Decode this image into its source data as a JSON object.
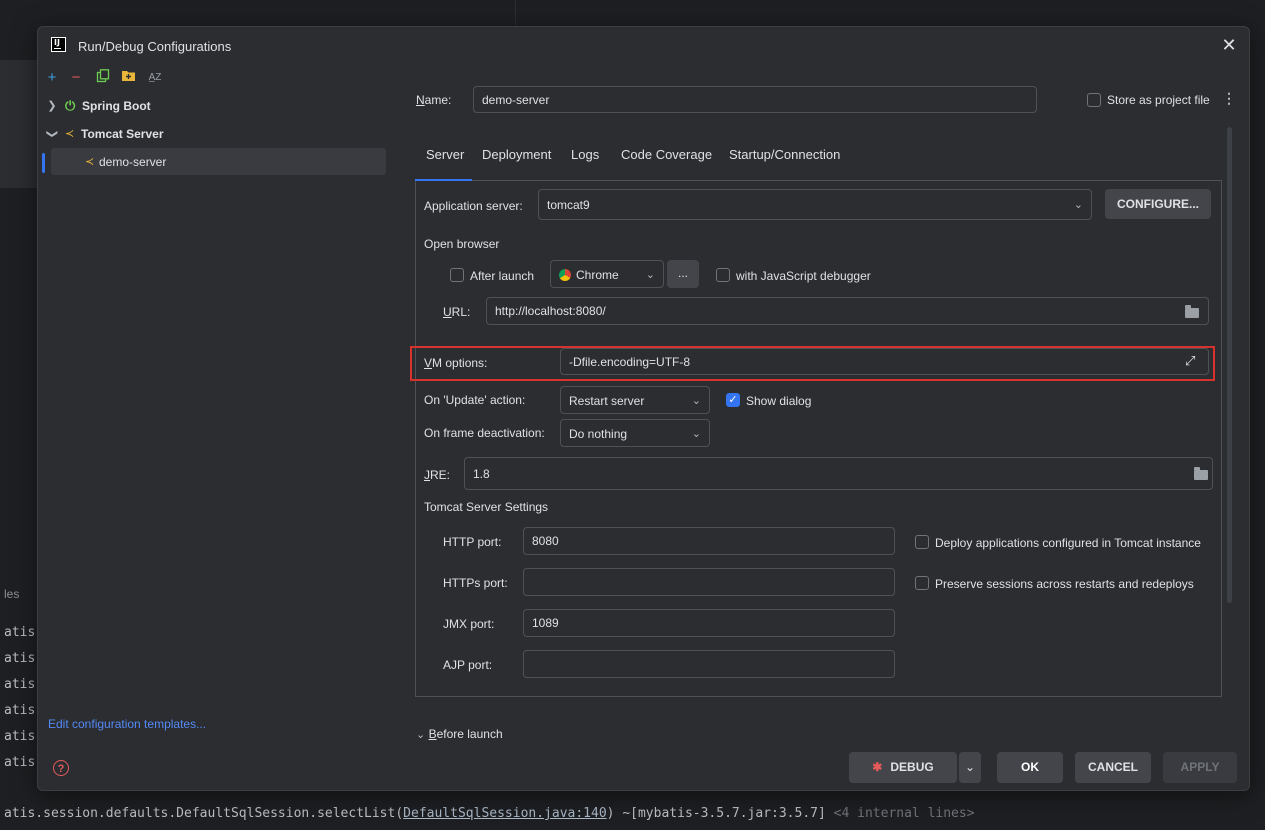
{
  "background": {
    "side_label": "les",
    "console_lines": [
      "atis.",
      "atis.",
      "atis.",
      "atis.",
      "atis.",
      "atis."
    ],
    "last_line": {
      "prefix": "atis.session.defaults.DefaultSqlSession.selectList(",
      "link": "DefaultSqlSession.java:140",
      "suffix": ") ~[mybatis-3.5.7.jar:3.5.7]",
      "dim": " <4 internal lines>"
    }
  },
  "dialog": {
    "title": "Run/Debug Configurations",
    "app_icon_text": "IJ"
  },
  "toolbar": {
    "icons": [
      "add-icon",
      "remove-icon",
      "copy-icon",
      "folder-icon",
      "sort-icon"
    ]
  },
  "tree": {
    "spring_boot": "Spring Boot",
    "tomcat_server": "Tomcat Server",
    "demo_server": "demo-server"
  },
  "left_footer": {
    "edit_templates": "Edit configuration templates...",
    "help": "?"
  },
  "name_row": {
    "label": "Name:",
    "value": "demo-server",
    "store_label": "Store as project file"
  },
  "tabs": [
    "Server",
    "Deployment",
    "Logs",
    "Code Coverage",
    "Startup/Connection"
  ],
  "server": {
    "app_server_label": "Application server:",
    "app_server_value": "tomcat9",
    "configure_btn": "CONFIGURE...",
    "open_browser": "Open browser",
    "after_launch": "After launch",
    "browser": "Chrome",
    "ellipsis": "...",
    "js_debugger": "with JavaScript debugger",
    "url_label": "URL:",
    "url_value": "http://localhost:8080/",
    "vm_label": "VM options:",
    "vm_value": "-Dfile.encoding=UTF-8",
    "update_label": "On 'Update' action:",
    "update_value": "Restart server",
    "show_dialog": "Show dialog",
    "frame_label": "On frame deactivation:",
    "frame_value": "Do nothing",
    "jre_label": "JRE:",
    "jre_value": "1.8",
    "tomcat_settings": "Tomcat Server Settings",
    "http_label": "HTTP port:",
    "http_value": "8080",
    "https_label": "HTTPs port:",
    "https_value": "",
    "jmx_label": "JMX port:",
    "jmx_value": "1089",
    "ajp_label": "AJP port:",
    "ajp_value": "",
    "deploy_check": "Deploy applications configured in Tomcat instance",
    "preserve_check": "Preserve sessions across restarts and redeploys"
  },
  "before_launch": "Before launch",
  "footer": {
    "debug": "DEBUG",
    "ok": "OK",
    "cancel": "CANCEL",
    "apply": "APPLY"
  },
  "colors": {
    "accent": "#3574f0",
    "highlight": "#d8322f",
    "link": "#548af7"
  }
}
